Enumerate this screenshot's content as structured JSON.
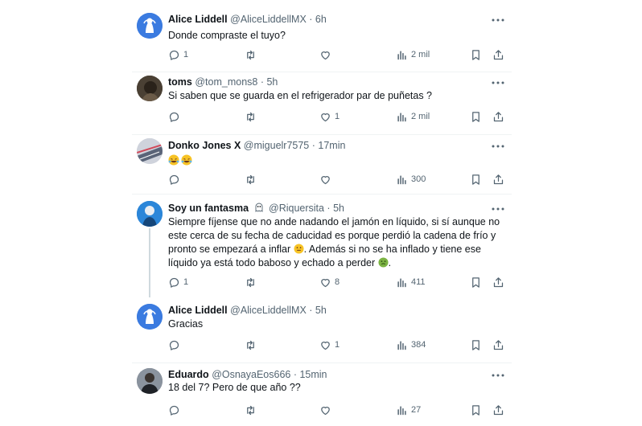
{
  "tweets": [
    {
      "name": "Alice Liddell",
      "meta": "@AliceLiddellMX · 6h",
      "text": [
        "Donde compraste el tuyo?"
      ],
      "replies": "1",
      "retweets": "",
      "likes": "",
      "views": "2 mil"
    },
    {
      "name": "toms",
      "meta": "@tom_mons8 · 5h",
      "text": [
        "Si saben que se guarda en el refrigerador par de puñetas ?"
      ],
      "replies": "",
      "retweets": "",
      "likes": "1",
      "views": "2 mil"
    },
    {
      "name": "Donko Jones X",
      "meta": "@miguelr7575 · 17min",
      "text": [],
      "replies": "",
      "retweets": "",
      "likes": "",
      "views": "300"
    },
    {
      "name": "Soy un fantasma",
      "meta": "@Riquersita · 5h",
      "text": [
        "Siempre fíjense que no ande nadando el jamón en líquido, si sí aunque no",
        "este cerca de su fecha de caducidad es porque perdió la cadena de frío y",
        "pronto se empezará a inflar",
        ". Además si no se ha inflado y tiene ese",
        "líquido ya está todo baboso y echado a perder",
        "."
      ],
      "replies": "1",
      "retweets": "",
      "likes": "8",
      "views": "411"
    },
    {
      "name": "Alice Liddell",
      "meta": "@AliceLiddellMX · 5h",
      "text": [
        "Gracias"
      ],
      "replies": "",
      "retweets": "",
      "likes": "1",
      "views": "384"
    },
    {
      "name": "Eduardo",
      "meta": "@OsnayaEos666 · 15min",
      "text": [
        "18 del 7? Pero de que año ??"
      ],
      "replies": "",
      "retweets": "",
      "likes": "",
      "views": "27"
    }
  ],
  "icons": {
    "reply": "reply-icon",
    "retweet": "retweet-icon",
    "like": "heart-icon",
    "views": "views-icon",
    "bookmark": "bookmark-icon",
    "share": "share-icon",
    "more": "more-icon"
  },
  "colors": {
    "text": "#0f1419",
    "muted": "#536471",
    "separator": "#eff3f4",
    "thread": "#cfd9de"
  }
}
